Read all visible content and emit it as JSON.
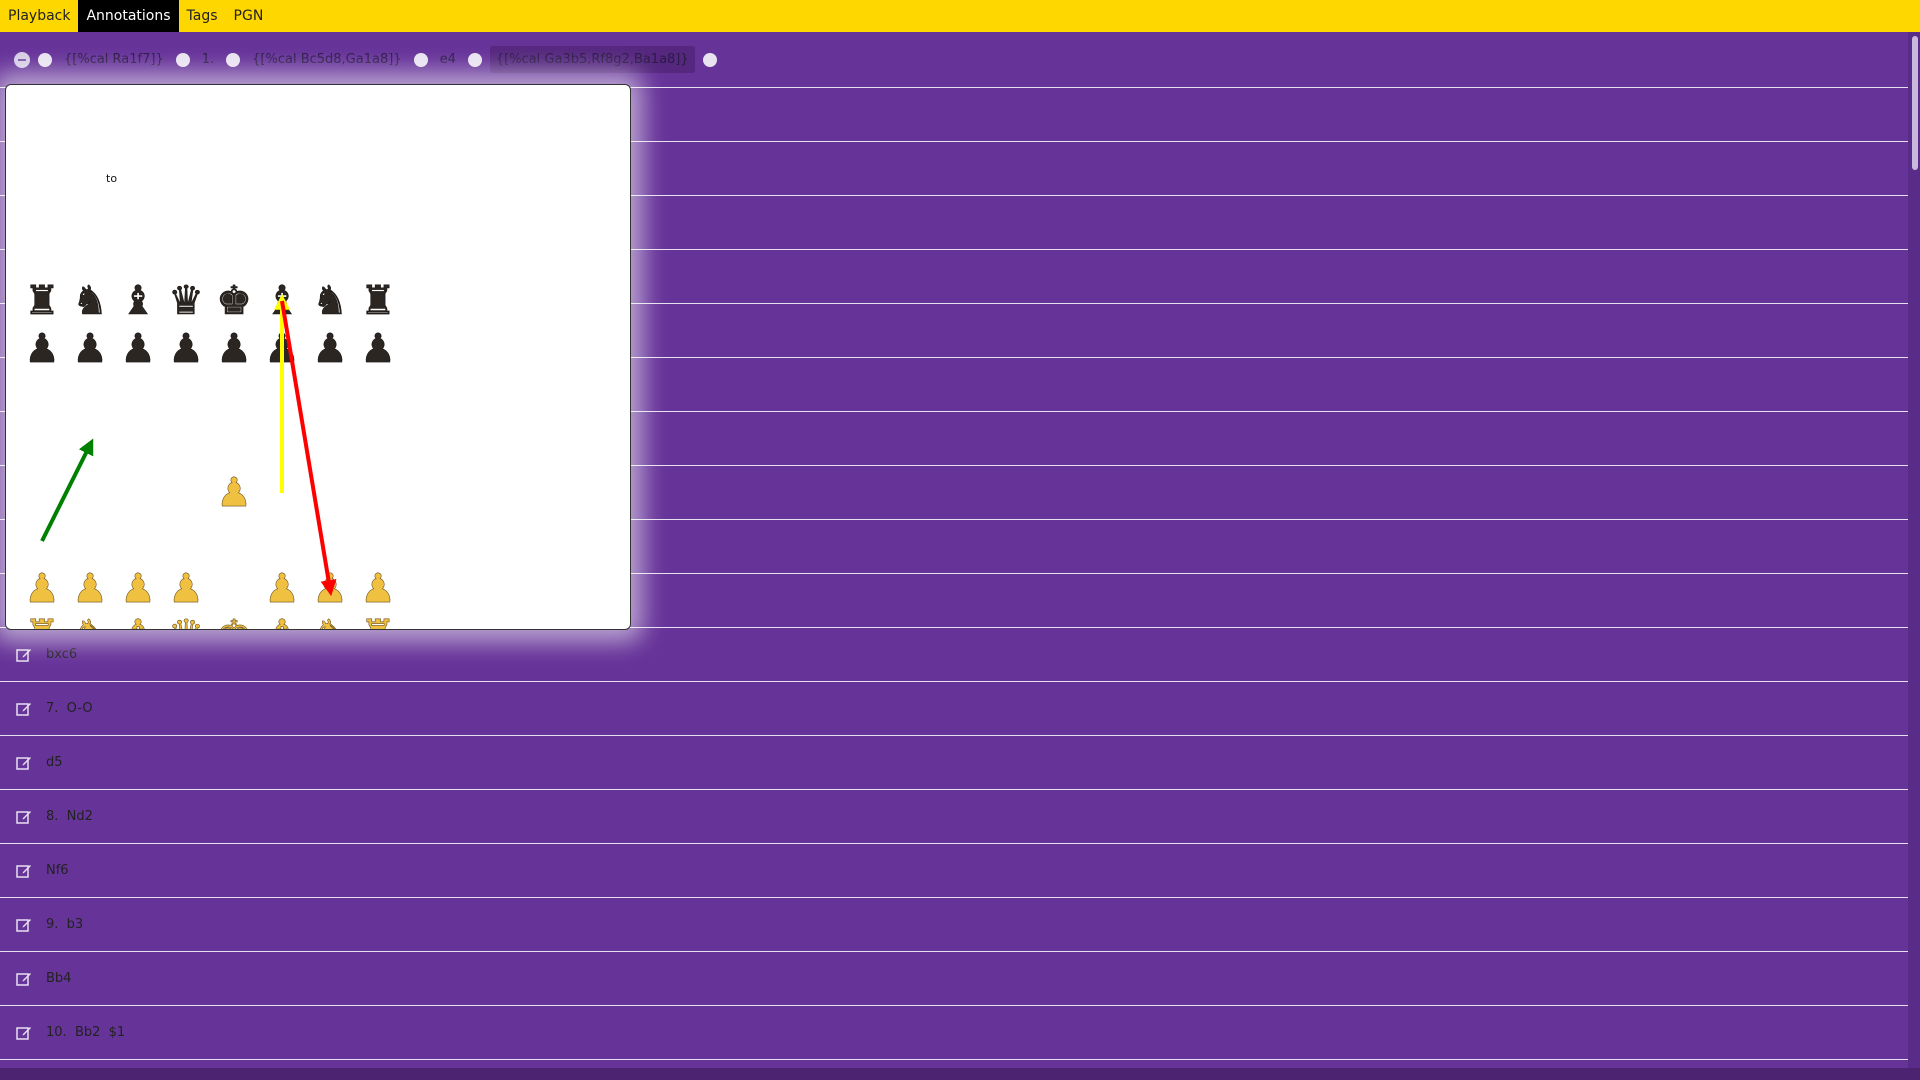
{
  "menu": {
    "tabs": [
      {
        "label": "Playback",
        "active": false
      },
      {
        "label": "Annotations",
        "active": true
      },
      {
        "label": "Tags",
        "active": false
      },
      {
        "label": "PGN",
        "active": false
      }
    ]
  },
  "toolbar": {
    "items": [
      "{[%cal Ra1f7]}",
      "1.",
      "{[%cal Bc5d8,Ga1a8]}",
      "e4",
      "{[%cal Ga3b5,Rf8g2,Ba1a8]}"
    ],
    "active_index": 4
  },
  "board": {
    "caption": "to",
    "pieces": {
      "black_back": [
        "rook",
        "knight",
        "bishop",
        "queen",
        "king",
        "bishop",
        "knight",
        "rook"
      ],
      "black_pawns": 8,
      "white_pawns_files": [
        "a",
        "b",
        "c",
        "d",
        "f",
        "g",
        "h"
      ],
      "white_pawn_advanced": "e4",
      "white_back": [
        "rook",
        "knight",
        "bishop",
        "queen",
        "king",
        "bishop",
        "knight",
        "rook"
      ]
    },
    "arrows": [
      {
        "color": "#008000",
        "from": "a3",
        "to": "b5"
      },
      {
        "color": "#ffff00",
        "from": "f4",
        "to": "f8"
      },
      {
        "color": "#ff0000",
        "from": "f8",
        "to": "g2"
      }
    ]
  },
  "moves": [
    "bxc6",
    "7.  O-O",
    "d5",
    "8.  Nd2",
    "Nf6",
    "9.  b3",
    "Bb4",
    "10.  Bb2  $1"
  ],
  "colors": {
    "background": "#663399",
    "menubar": "#ffd700",
    "active_tab": "#000000"
  }
}
